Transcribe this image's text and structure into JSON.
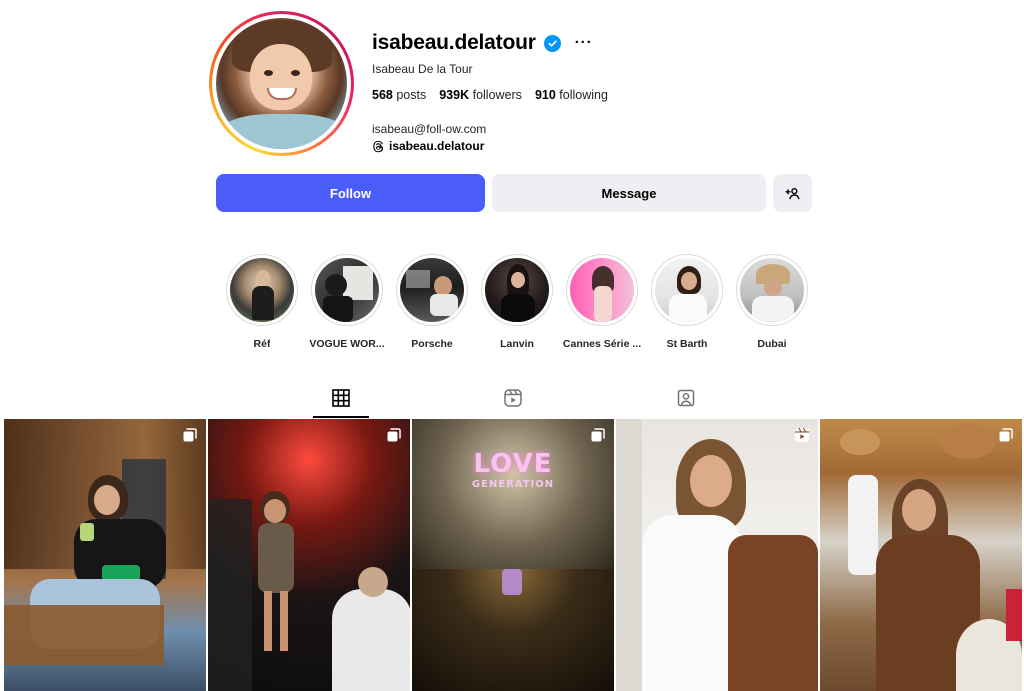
{
  "profile": {
    "username": "isabeau.delatour",
    "full_name": "Isabeau De la Tour",
    "email": "isabeau@foll-ow.com",
    "threads_handle": "isabeau.delatour",
    "more_label": "···",
    "verified_icon": "verified-badge-icon"
  },
  "stats": {
    "posts_count": "568",
    "posts_label": "posts",
    "followers_count": "939K",
    "followers_label": "followers",
    "following_count": "910",
    "following_label": "following"
  },
  "actions": {
    "follow_label": "Follow",
    "message_label": "Message",
    "add_user_icon": "add-user-icon"
  },
  "colors": {
    "follow_button": "#4a5df9",
    "secondary_button": "#efeff3",
    "verified": "#0095f6"
  },
  "highlights": [
    {
      "label": "Réf"
    },
    {
      "label": "VOGUE WOR..."
    },
    {
      "label": "Porsche"
    },
    {
      "label": "Lanvin"
    },
    {
      "label": "Cannes Série ..."
    },
    {
      "label": "St Barth"
    },
    {
      "label": "Dubai"
    }
  ],
  "tabs": [
    {
      "name": "posts",
      "icon": "grid-icon",
      "active": true
    },
    {
      "name": "reels",
      "icon": "reels-icon",
      "active": false
    },
    {
      "name": "tagged",
      "icon": "tagged-icon",
      "active": false
    }
  ],
  "posts": [
    {
      "badge": "carousel-icon"
    },
    {
      "badge": "carousel-icon"
    },
    {
      "badge": "carousel-icon",
      "overlay_title": "LOVE",
      "overlay_subtitle": "GENERATION"
    },
    {
      "badge": "reel-icon"
    },
    {
      "badge": "carousel-icon"
    }
  ]
}
